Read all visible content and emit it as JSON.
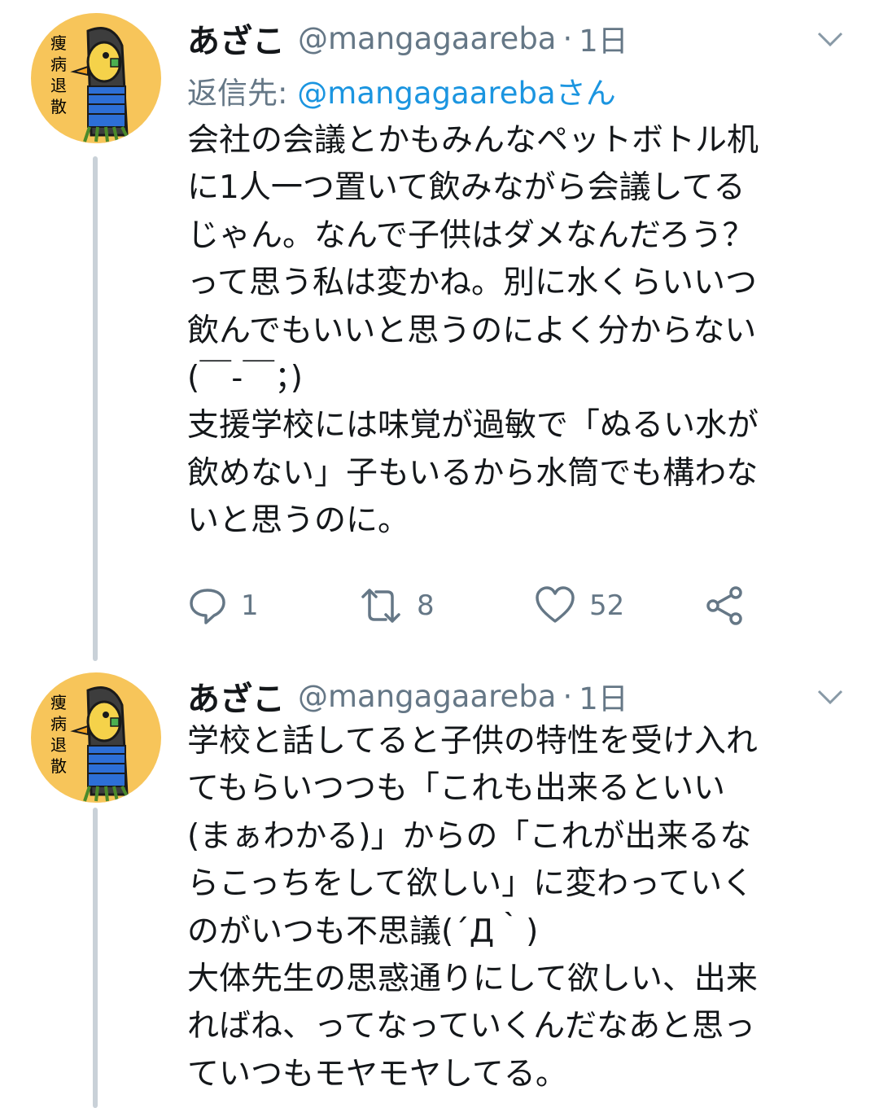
{
  "colors": {
    "text": "#14171a",
    "secondary": "#657786",
    "link": "#1b95e0",
    "thread_line": "#c9d1d8",
    "avatar_bg": "#f7c55a"
  },
  "avatar": {
    "kanji": [
      "痩",
      "病",
      "退",
      "散"
    ]
  },
  "tweets": [
    {
      "name": "あざこ",
      "handle": "@mangagaareba",
      "dot": "·",
      "time": "1日",
      "reply_prefix": "返信先:",
      "reply_mention": "@mangagaarebaさん",
      "lines": [
        "会社の会議とかもみんなペットボトル机",
        "に1人一つ置いて飲みながら会議してる",
        "じゃん。なんで子供はダメなんだろう？",
        "って思う私は変かね。別に水くらいいつ",
        "飲んでもいいと思うのによく分からない",
        "(￣-￣；)",
        "支援学校には味覚が過敏で「ぬるい水が",
        "飲めない」子もいるから水筒でも構わな",
        "いと思うのに。"
      ],
      "actions": {
        "reply_icon": "reply-icon",
        "reply_count": "1",
        "retweet_icon": "retweet-icon",
        "retweet_count": "8",
        "like_icon": "heart-icon",
        "like_count": "52",
        "share_icon": "share-icon"
      }
    },
    {
      "name": "あざこ",
      "handle": "@mangagaareba",
      "dot": "·",
      "time": "1日",
      "lines": [
        "学校と話してると子供の特性を受け入れ",
        "てもらいつつも「これも出来るといい",
        "(まぁわかる)」からの「これが出来るな",
        "らこっちをして欲しい」に変わっていく",
        "のがいつも不思議(´Д｀)",
        "大体先生の思惑通りにして欲しい、出来",
        "ればね、ってなっていくんだなあと思っ",
        "ていつもモヤモヤしてる。"
      ]
    }
  ]
}
